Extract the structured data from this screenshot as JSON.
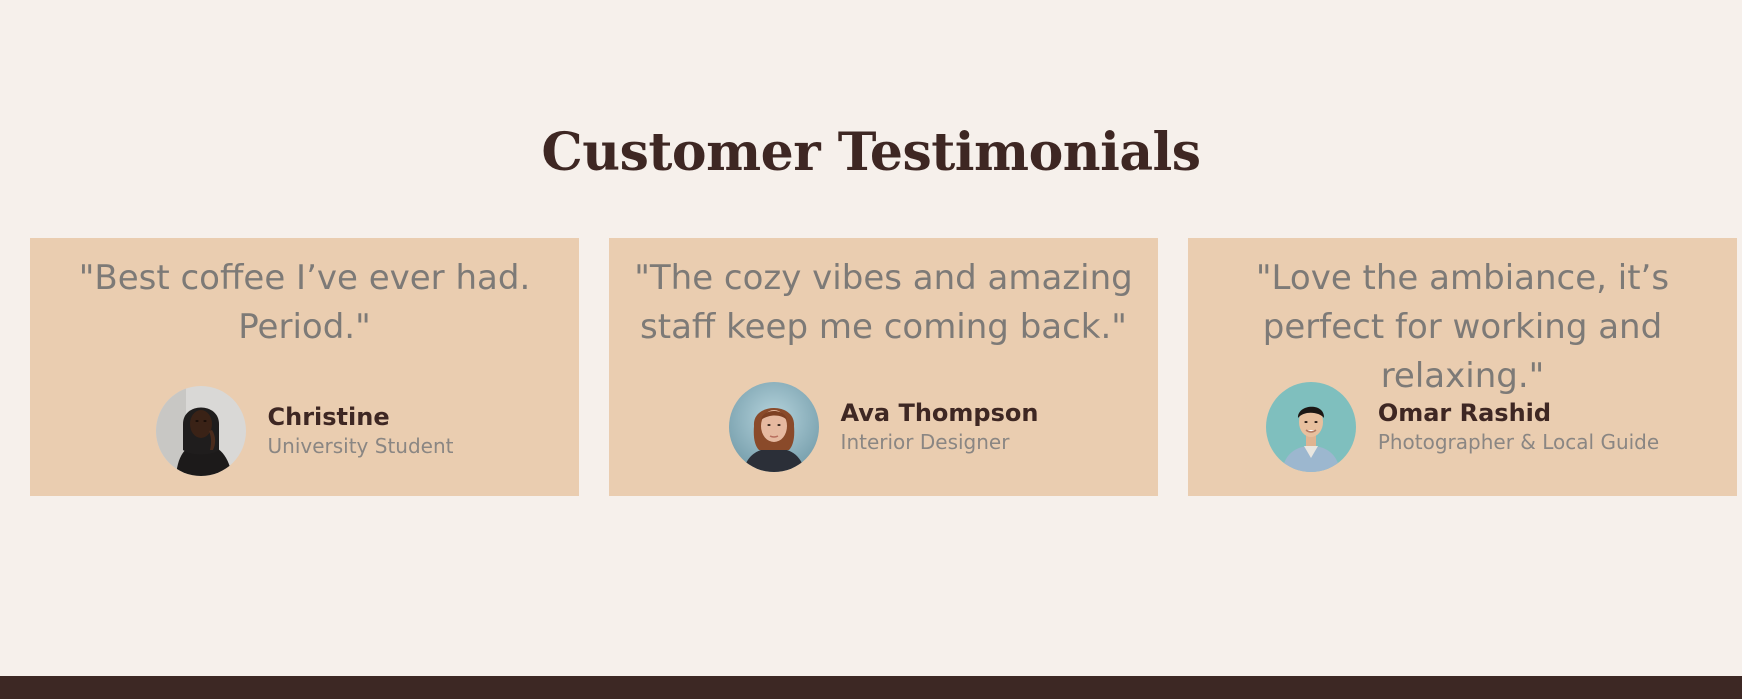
{
  "section": {
    "title": "Customer Testimonials"
  },
  "testimonials": [
    {
      "quote": "\"Best coffee I’ve ever had. Period.\"",
      "name": "Christine",
      "role": "University Student"
    },
    {
      "quote": "\"The cozy vibes and amazing staff keep me coming back.\"",
      "name": "Ava Thompson",
      "role": "Interior Designer"
    },
    {
      "quote": "\"Love the ambiance, it’s perfect for working and relaxing.\"",
      "name": "Omar Rashid",
      "role": "Photographer & Local Guide"
    }
  ],
  "colors": {
    "page_background": "#f6f0eb",
    "card_background": "#eacdb0",
    "heading": "#3e2723",
    "quote_text": "#7d7a77",
    "role_text": "#8a8683",
    "footer": "#3d2824"
  }
}
